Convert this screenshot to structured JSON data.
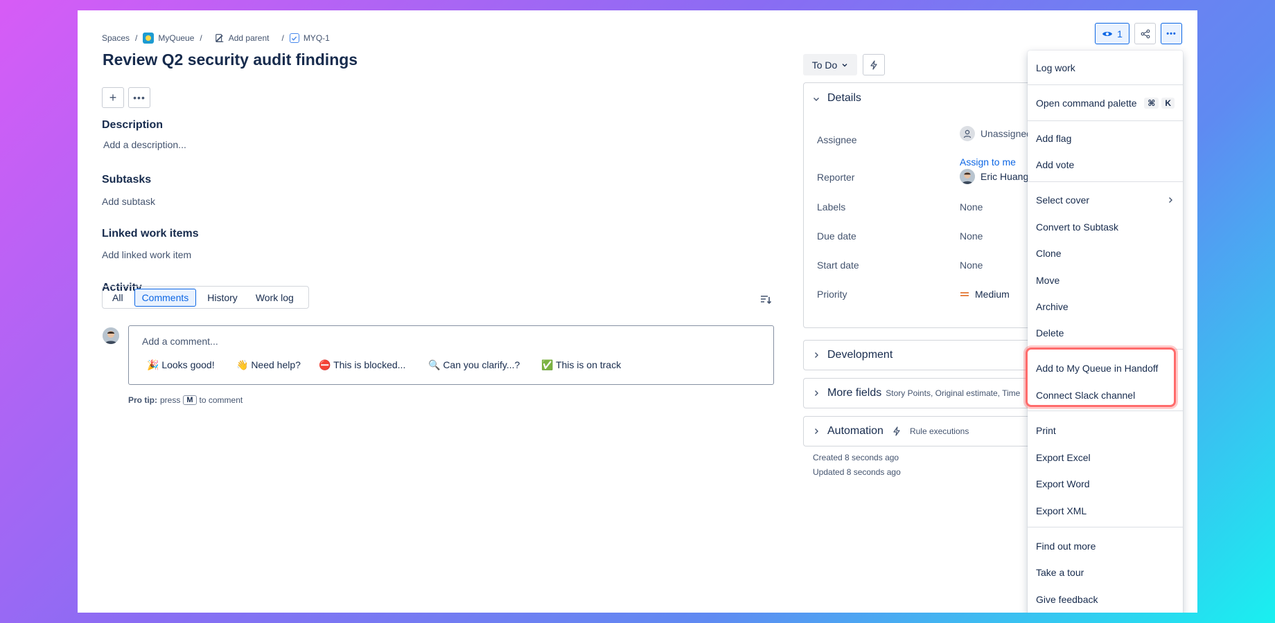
{
  "breadcrumb": {
    "spaces": "Spaces",
    "project": "MyQueue",
    "add_parent": "Add parent",
    "key": "MYQ-1",
    "sep": "/"
  },
  "issue": {
    "title": "Review Q2 security audit findings"
  },
  "description": {
    "heading": "Description",
    "placeholder": "Add a description..."
  },
  "subtasks": {
    "heading": "Subtasks",
    "action": "Add subtask"
  },
  "linked": {
    "heading": "Linked work items",
    "action": "Add linked work item"
  },
  "activity": {
    "heading": "Activity",
    "tabs": [
      "All",
      "Comments",
      "History",
      "Work log"
    ],
    "comment_placeholder": "Add a comment...",
    "quick_replies": [
      "🎉 Looks good!",
      "👋 Need help?",
      "⛔ This is blocked...",
      "🔍 Can you clarify...?",
      "✅ This is on track"
    ],
    "protip_prefix": "Pro tip:",
    "protip_press": "press",
    "protip_key": "M",
    "protip_suffix": "to comment"
  },
  "status": {
    "label": "To Do"
  },
  "details": {
    "heading": "Details",
    "fields": [
      {
        "label": "Assignee",
        "value": "Unassigned"
      },
      {
        "label": "Reporter",
        "value": "Eric Huang"
      },
      {
        "label": "Labels",
        "value": "None"
      },
      {
        "label": "Due date",
        "value": "None"
      },
      {
        "label": "Start date",
        "value": "None"
      },
      {
        "label": "Priority",
        "value": "Medium"
      }
    ],
    "assign_to_me": "Assign to me"
  },
  "development": {
    "heading": "Development"
  },
  "more_fields": {
    "heading": "More fields",
    "hint": "Story Points, Original estimate, Time"
  },
  "automation": {
    "heading": "Automation",
    "hint": "Rule executions"
  },
  "meta": {
    "created": "Created 8 seconds ago",
    "updated": "Updated 8 seconds ago"
  },
  "watchers": {
    "count": "1"
  },
  "menu": {
    "items": [
      "Log work",
      "Open command palette",
      "Add flag",
      "Add vote",
      "Select cover",
      "Convert to Subtask",
      "Clone",
      "Move",
      "Archive",
      "Delete",
      "Add to My Queue in Handoff",
      "Connect Slack channel",
      "Print",
      "Export Excel",
      "Export Word",
      "Export XML",
      "Find out more",
      "Take a tour",
      "Give feedback"
    ],
    "shortcut": [
      "⌘",
      "K"
    ]
  },
  "colors": {
    "accent": "#0c66e4",
    "highlight": "#ff6b6b",
    "priority_medium": "#e2742f"
  }
}
